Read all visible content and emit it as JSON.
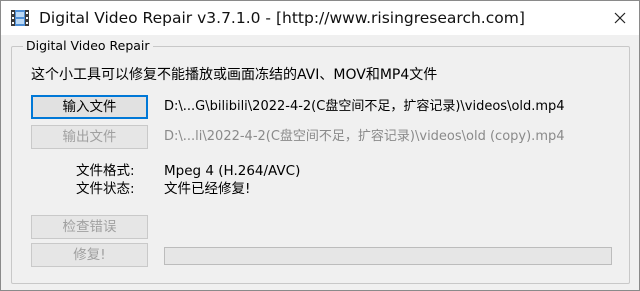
{
  "window": {
    "title": "Digital Video Repair v3.7.1.0 - [http://www.risingresearch.com]"
  },
  "group": {
    "title": "Digital Video Repair"
  },
  "description": "这个小工具可以修复不能播放或画面冻结的AVI、MOV和MP4文件",
  "input": {
    "button_label": "输入文件",
    "path": "D:\\...G\\bilibili\\2022-4-2(C盘空间不足，扩容记录)\\videos\\old.mp4"
  },
  "output": {
    "button_label": "输出文件",
    "path": "D:\\...li\\2022-4-2(C盘空间不足，扩容记录)\\videos\\old (copy).mp4"
  },
  "info": {
    "format_label": "文件格式:",
    "format_value": "Mpeg 4 (H.264/AVC)",
    "status_label": "文件状态:",
    "status_value": "文件已经修复!"
  },
  "actions": {
    "check_label": "检查错误",
    "repair_label": "修复!"
  },
  "progress": {
    "fraction": 0,
    "fill_color": "#06b025"
  },
  "icons": {
    "app": "film-strip-icon",
    "close": "close-icon"
  }
}
